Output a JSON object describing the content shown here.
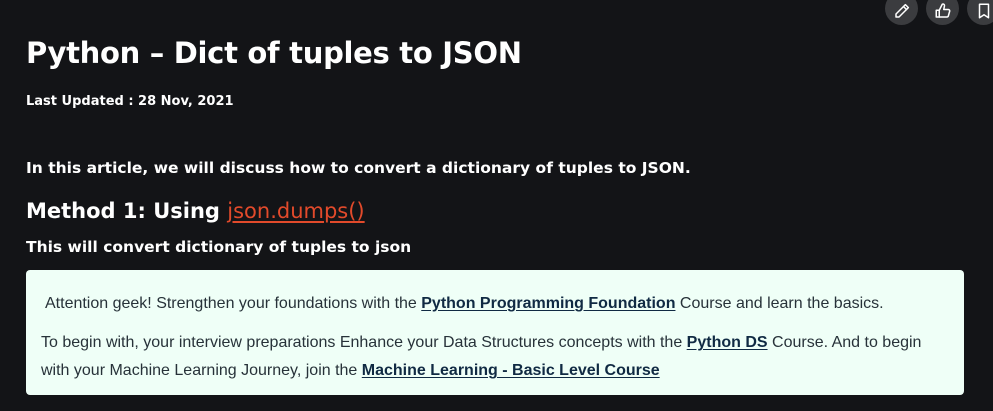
{
  "article": {
    "title": "Python – Dict of tuples to JSON",
    "last_updated": "Last Updated : 28 Nov, 2021",
    "intro": "In this article, we will discuss how to convert a dictionary of tuples to JSON.",
    "method_heading": "Method 1: Using ",
    "method_link": "json.dumps()",
    "method_desc": "This will convert dictionary of tuples to json"
  },
  "actions": {
    "edit_icon": "pencil-icon",
    "like_icon": "thumbs-up-icon",
    "bookmark_icon": "bookmark-icon"
  },
  "notice": {
    "line1_prefix": "Attention geek! Strengthen your foundations with the ",
    "line1_link": "Python Programming Foundation",
    "line1_suffix": " Course and learn the basics.",
    "line2_prefix": "To begin with, your interview preparations Enhance your Data Structures concepts with the ",
    "line2_link": "Python DS",
    "line2_middle": " Course. And to begin with your Machine Learning Journey, join the ",
    "line2_link2": "Machine Learning - Basic Level Course"
  },
  "colors": {
    "background": "#131417",
    "link_accent": "#e24a2b",
    "notice_bg": "#effff7",
    "notice_text": "#273239"
  }
}
